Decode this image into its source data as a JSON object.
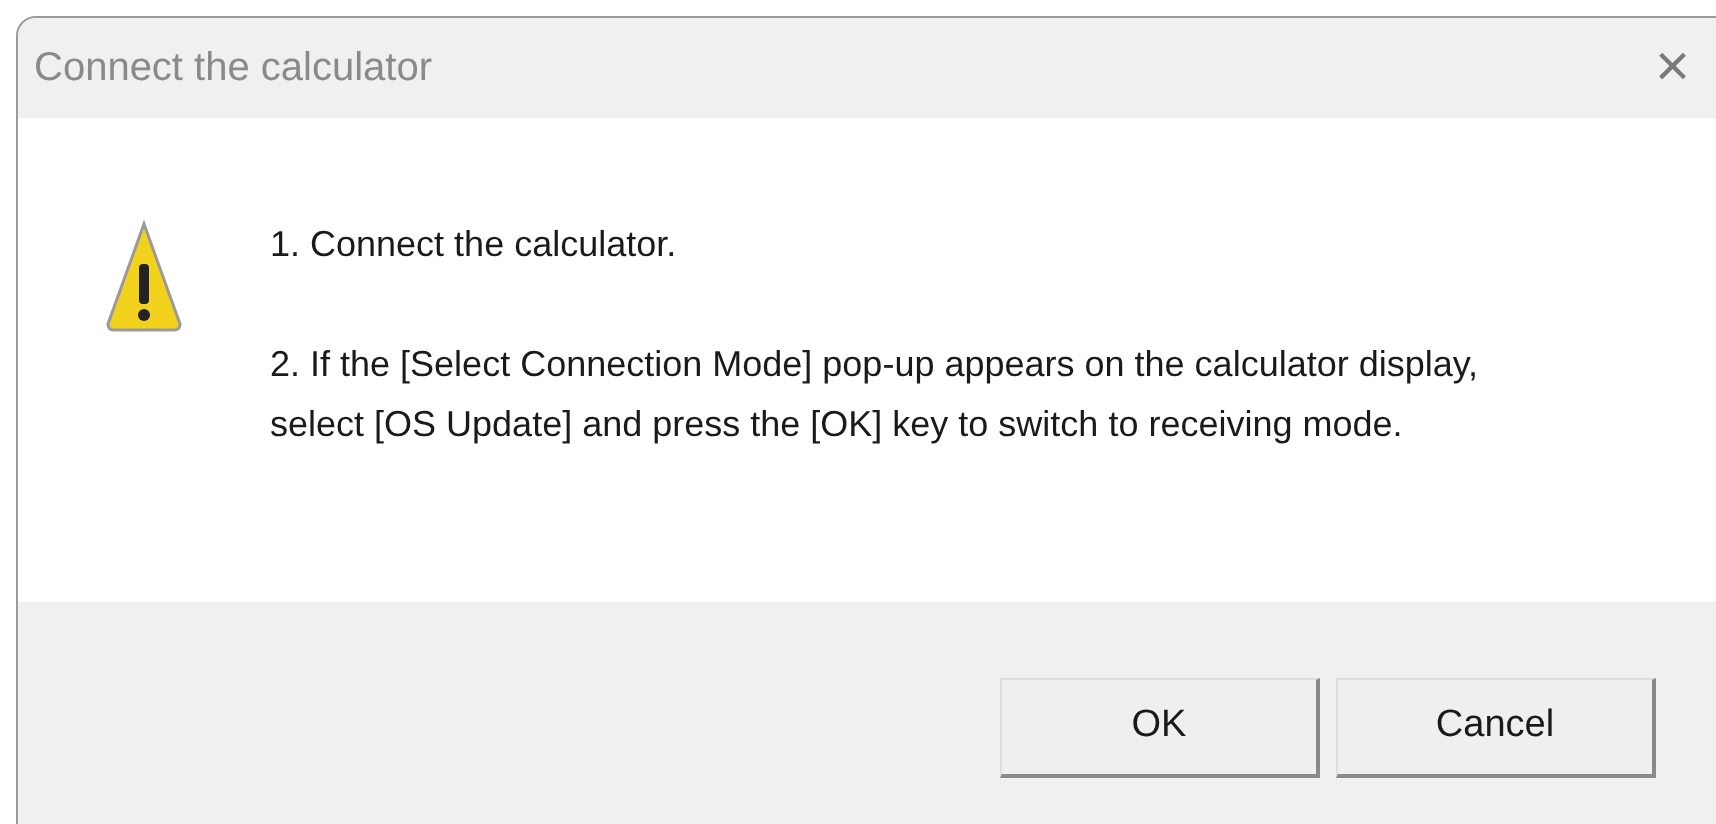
{
  "window": {
    "title": "Connect the calculator",
    "close": "×"
  },
  "message": {
    "steps": [
      "1. Connect the calculator.",
      "2. If the [Select Connection Mode] pop-up appears on the calculator display, select [OS Update] and press the [OK] key to switch to receiving mode."
    ]
  },
  "buttons": [
    "OK",
    "Cancel"
  ]
}
